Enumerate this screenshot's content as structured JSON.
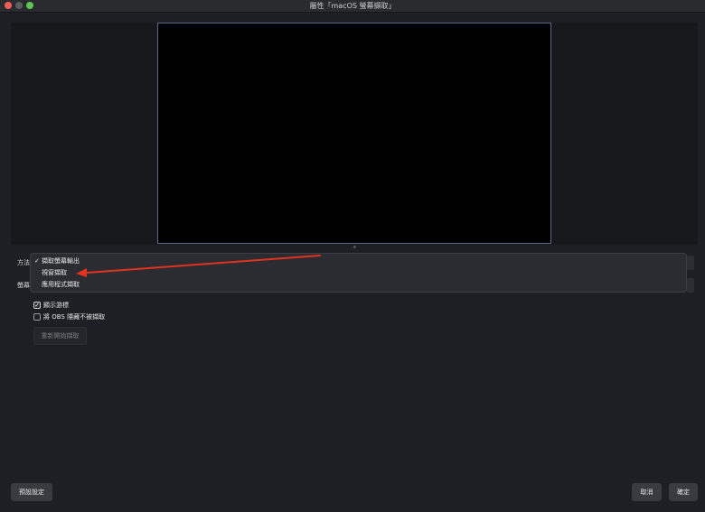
{
  "window": {
    "title": "屬性「macOS 螢幕擷取」"
  },
  "form": {
    "method_label": "方法",
    "screen_label": "螢幕"
  },
  "method_dropdown": {
    "options": [
      {
        "label": "擷取螢幕輸出",
        "selected": true
      },
      {
        "label": "視窗擷取",
        "selected": false
      },
      {
        "label": "應用程式擷取",
        "selected": false
      }
    ],
    "check_mark": "✓"
  },
  "options": {
    "show_cursor": {
      "label": "顯示游標",
      "checked": true
    },
    "hide_obs": {
      "label": "將 OBS 隱藏不被擷取",
      "checked": false
    }
  },
  "buttons": {
    "restart_capture": "重新開始擷取",
    "defaults": "預設設定",
    "cancel": "取消",
    "ok": "確定"
  },
  "annotation": {
    "arrow_color": "#e0321e"
  }
}
